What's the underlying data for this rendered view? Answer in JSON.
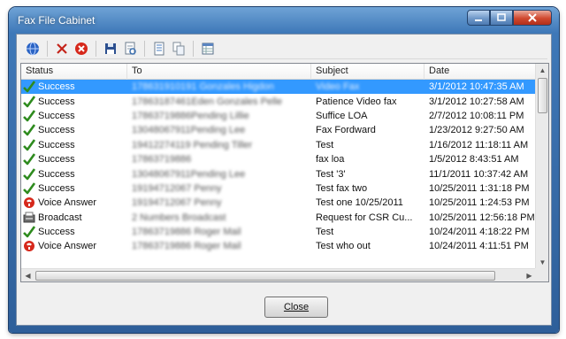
{
  "window": {
    "title": "Fax File Cabinet"
  },
  "columns": [
    "Status",
    "To",
    "Subject",
    "Date"
  ],
  "rows": [
    {
      "status": "Success",
      "status_icon": "check-icon",
      "to": "178631910191 Gonzales Higdon",
      "subject": "Video Fax",
      "date": "3/1/2012 10:47:35 AM",
      "selected": true
    },
    {
      "status": "Success",
      "status_icon": "check-icon",
      "to": "17863187461Eden Gonzales Pelle",
      "subject": "Patience Video fax",
      "date": "3/1/2012 10:27:58 AM",
      "selected": false
    },
    {
      "status": "Success",
      "status_icon": "check-icon",
      "to": "17863719886Pending Lillie",
      "subject": "Suffice LOA",
      "date": "2/7/2012 10:08:11 PM",
      "selected": false
    },
    {
      "status": "Success",
      "status_icon": "check-icon",
      "to": "13048067911Pending Lee",
      "subject": "Fax Fordward",
      "date": "1/23/2012 9:27:50 AM",
      "selected": false
    },
    {
      "status": "Success",
      "status_icon": "check-icon",
      "to": "19412274119 Pending Tiller",
      "subject": "Test",
      "date": "1/16/2012 11:18:11 AM",
      "selected": false
    },
    {
      "status": "Success",
      "status_icon": "check-icon",
      "to": "17863719886",
      "subject": "fax loa",
      "date": "1/5/2012 8:43:51 AM",
      "selected": false
    },
    {
      "status": "Success",
      "status_icon": "check-icon",
      "to": "13048067911Pending Lee",
      "subject": "Test '3'",
      "date": "11/1/2011 10:37:42 AM",
      "selected": false
    },
    {
      "status": "Success",
      "status_icon": "check-icon",
      "to": "19194712067 Penny",
      "subject": "Test fax two",
      "date": "10/25/2011 1:31:18 PM",
      "selected": false
    },
    {
      "status": "Voice Answer",
      "status_icon": "voice-answer-icon",
      "to": "19194712067 Penny",
      "subject": "Test one 10/25/2011",
      "date": "10/25/2011 1:24:53 PM",
      "selected": false
    },
    {
      "status": "Broadcast",
      "status_icon": "broadcast-icon",
      "to": "2 Numbers Broadcast",
      "subject": "Request for CSR Cu...",
      "date": "10/25/2011 12:56:18 PM",
      "selected": false
    },
    {
      "status": "Success",
      "status_icon": "check-icon",
      "to": "17863719886 Roger Mail",
      "subject": "Test",
      "date": "10/24/2011 4:18:22 PM",
      "selected": false
    },
    {
      "status": "Voice Answer",
      "status_icon": "voice-answer-icon",
      "to": "17863719886 Roger Mail",
      "subject": "Test who out",
      "date": "10/24/2011 4:11:51 PM",
      "selected": false
    }
  ],
  "footer": {
    "close_label": "Close"
  },
  "colors": {
    "selection": "#3399ff",
    "check": "#2e8b1e",
    "error": "#d6281b",
    "frame": "#3e78b8"
  }
}
